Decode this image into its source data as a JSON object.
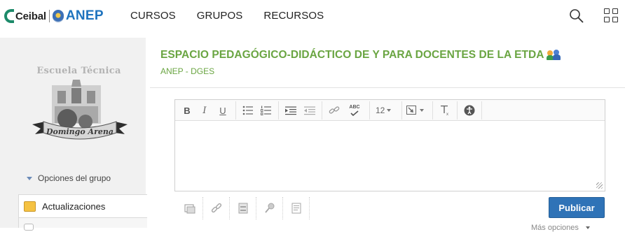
{
  "brand": {
    "ceibal": "Ceibal",
    "anep": "ANEP"
  },
  "nav": {
    "items": [
      "CURSOS",
      "GRUPOS",
      "RECURSOS"
    ]
  },
  "sidebar": {
    "school_title": "Escuela Técnica",
    "school_ribbon": "Domingo Arena",
    "group_options": "Opciones del grupo",
    "updates_label": "Actualizaciones"
  },
  "space": {
    "title": "ESPACIO PEDAGÓGICO-DIDÁCTICO DE Y PARA DOCENTES DE LA ETDA",
    "subtitle": "ANEP - DGES"
  },
  "editor": {
    "toolbar": {
      "bold": "B",
      "italic": "I",
      "underline": "U",
      "font_size": "12",
      "spellcheck": "ABC"
    }
  },
  "actions": {
    "publish": "Publicar",
    "more": "Más opciones"
  },
  "colors": {
    "accent_green": "#6aa542",
    "publish_blue": "#2f73b7",
    "anep_blue": "#1e73be"
  }
}
